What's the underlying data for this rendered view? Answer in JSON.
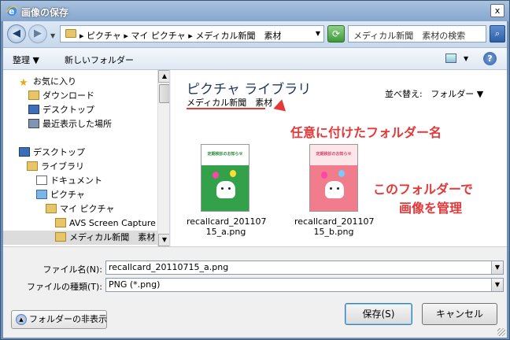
{
  "window": {
    "title": "画像の保存",
    "close_label": "x"
  },
  "address": {
    "path": "▸ ピクチャ ▸ マイ ピクチャ ▸ メディカル新聞　素材",
    "search_placeholder": "メディカル新聞　素材の検索"
  },
  "toolbar": {
    "organize": "整理 ▼",
    "new_folder": "新しいフォルダー",
    "help": "?"
  },
  "nav": {
    "items": [
      {
        "label": "お気に入り",
        "icon": "star-icon"
      },
      {
        "label": "ダウンロード",
        "icon": "download-icon"
      },
      {
        "label": "デスクトップ",
        "icon": "desktop-icon"
      },
      {
        "label": "最近表示した場所",
        "icon": "recent-icon"
      },
      {
        "label": "デスクトップ",
        "icon": "desktop-icon"
      },
      {
        "label": "ライブラリ",
        "icon": "library-icon"
      },
      {
        "label": "ドキュメント",
        "icon": "documents-icon"
      },
      {
        "label": "ピクチャ",
        "icon": "pictures-icon"
      },
      {
        "label": "マイ ピクチャ",
        "icon": "folder-icon"
      },
      {
        "label": "AVS Screen Capture",
        "icon": "folder-icon"
      },
      {
        "label": "メディカル新聞　素材",
        "icon": "folder-icon"
      }
    ]
  },
  "library": {
    "title": "ピクチャ ライブラリ",
    "subtitle": "メディカル新聞　素材",
    "arrange_by": "並べ替え:",
    "arrange_value": "フォルダー ▼"
  },
  "annotations": {
    "folder_name_note": "任意に付けたフォルダー名",
    "manage_line1": "このフォルダーで",
    "manage_line2": "画像を管理",
    "color": "#e63838"
  },
  "files": [
    {
      "line1": "recallcard_201107",
      "line2": "15_a.png",
      "thumb_title": "定期検診のお知らせ",
      "bg": "#33a14a"
    },
    {
      "line1": "recallcard_201107",
      "line2": "15_b.png",
      "thumb_title": "定期検診のお知らせ",
      "bg": "#f07c8c"
    }
  ],
  "form": {
    "filename_label": "ファイル名(N):",
    "filename_value": "recallcard_20110715_a.png",
    "filetype_label": "ファイルの種類(T):",
    "filetype_value": "PNG (*.png)",
    "save": "保存(S)",
    "cancel": "キャンセル",
    "hide_folders": "フォルダーの非表示"
  }
}
